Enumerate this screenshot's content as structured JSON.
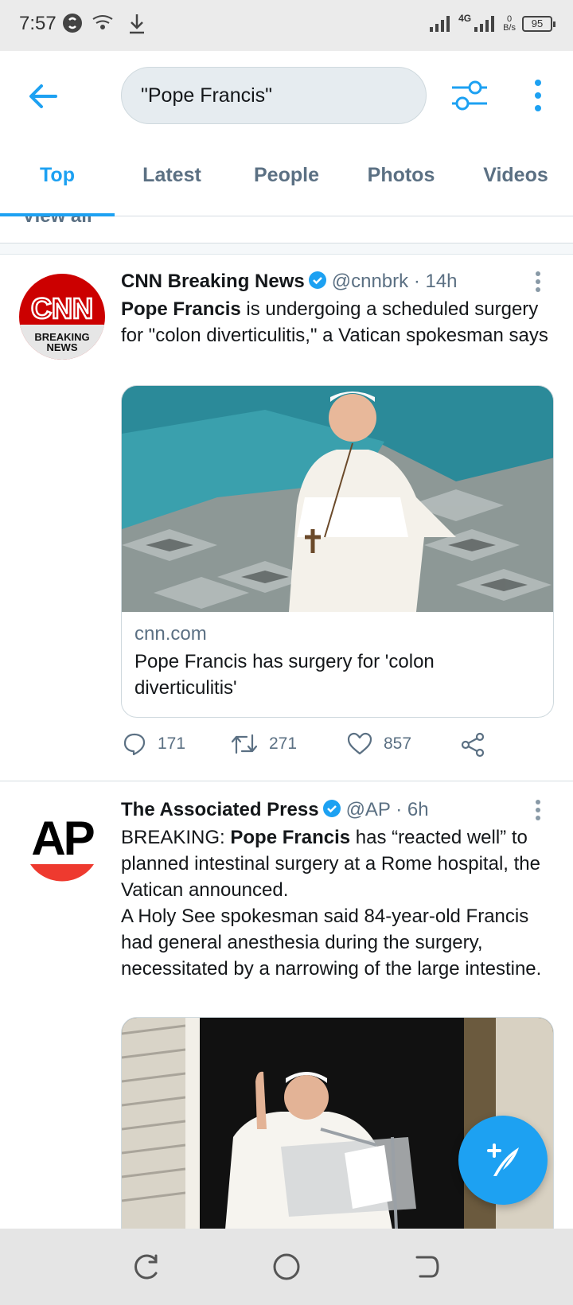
{
  "status_bar": {
    "time": "7:57",
    "network": "4G",
    "data_rate_value": "0",
    "data_rate_unit": "B/s",
    "battery": "95"
  },
  "header": {
    "search_value": "\"Pope Francis\"",
    "icons": [
      "back-arrow-icon",
      "filter-sliders-icon",
      "more-vertical-icon"
    ]
  },
  "tabs": [
    {
      "label": "Top",
      "active": true
    },
    {
      "label": "Latest",
      "active": false
    },
    {
      "label": "People",
      "active": false
    },
    {
      "label": "Photos",
      "active": false
    },
    {
      "label": "Videos",
      "active": false
    }
  ],
  "partial_text": "View all",
  "tweets": [
    {
      "avatar_text_top": "CNN",
      "avatar_text_bottom_1": "BREAKING",
      "avatar_text_bottom_2": "NEWS",
      "name": "CNN Breaking News",
      "handle": "@cnnbrk",
      "time": "· 14h",
      "text_bold": "Pope Francis",
      "text_rest": " is undergoing a scheduled surgery for \"colon diverticulitis,\" a Vatican spokesman says",
      "card": {
        "domain": "cnn.com",
        "title": "Pope Francis has surgery for 'colon diverticulitis'"
      },
      "replies": "171",
      "retweets": "271",
      "likes": "857"
    },
    {
      "avatar_text": "AP",
      "name": "The Associated Press",
      "handle": "@AP",
      "time": "· 6h",
      "text_prefix": "BREAKING: ",
      "text_bold": "Pope Francis",
      "text_rest": " has “reacted well” to planned intestinal surgery at a Rome hospital, the Vatican announced.",
      "text_para2": "A Holy See spokesman said 84-year-old Francis had general anesthesia during the surgery, necessitated by a narrowing of the large intestine."
    }
  ],
  "fab": {
    "icon": "compose-tweet-icon"
  },
  "colors": {
    "accent": "#1da1f2",
    "secondary_text": "#5b7083",
    "ap_red": "#ee3a2f",
    "cnn_red": "#cc0000"
  }
}
